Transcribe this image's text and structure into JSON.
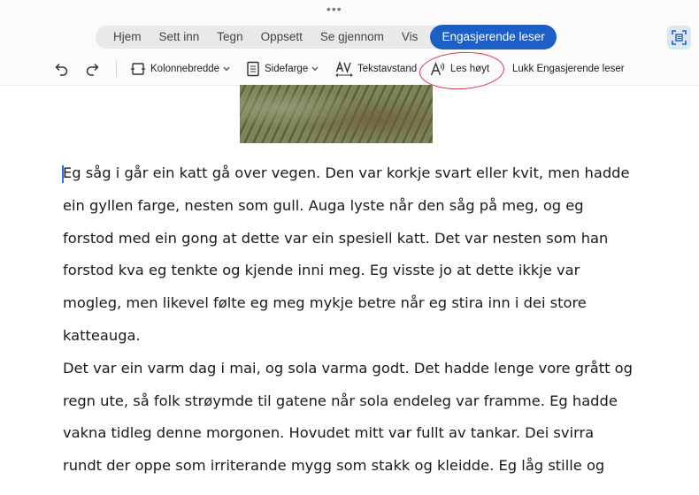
{
  "window": {
    "more_dots": "•••"
  },
  "tabs": [
    {
      "label": "Hjem"
    },
    {
      "label": "Sett inn"
    },
    {
      "label": "Tegn"
    },
    {
      "label": "Oppsett"
    },
    {
      "label": "Se gjennom"
    },
    {
      "label": "Vis"
    },
    {
      "label": "Engasjerende leser",
      "active": true
    }
  ],
  "toolbar": {
    "column_width": "Kolonnebredde",
    "page_color": "Sidefarge",
    "text_spacing": "Tekstavstand",
    "read_aloud": "Les høyt",
    "close_reader": "Lukk Engasjerende leser"
  },
  "colors": {
    "accent": "#1c5fc7",
    "annotation": "#d13a4a"
  },
  "document": {
    "lines": [
      "Eg såg i går ein katt gå over vegen. Den var korkje svart eller kvit, men hadde",
      "ein gyllen farge, nesten som gull. Auga lyste når den såg på meg, og eg",
      "forstod med ein gong at dette var ein spesiell katt. Det var nesten som han",
      "forstod kva eg tenkte og kjende inni meg. Eg visste jo at dette ikkje var",
      "mogleg, men likevel følte eg meg mykje betre når eg stira inn i dei store",
      "katteauga.",
      "Det var ein varm dag i mai, og sola varma godt. Det hadde lenge vore grått og",
      "regn ute, så folk strøymde til gatene når sola endeleg var framme. Eg hadde",
      "vakna tidleg denne morgonen. Hovudet mitt var fullt av tankar. Dei svirra",
      "rundt der oppe som irriterande mygg som stakk og kleidde. Eg låg stille og"
    ]
  }
}
